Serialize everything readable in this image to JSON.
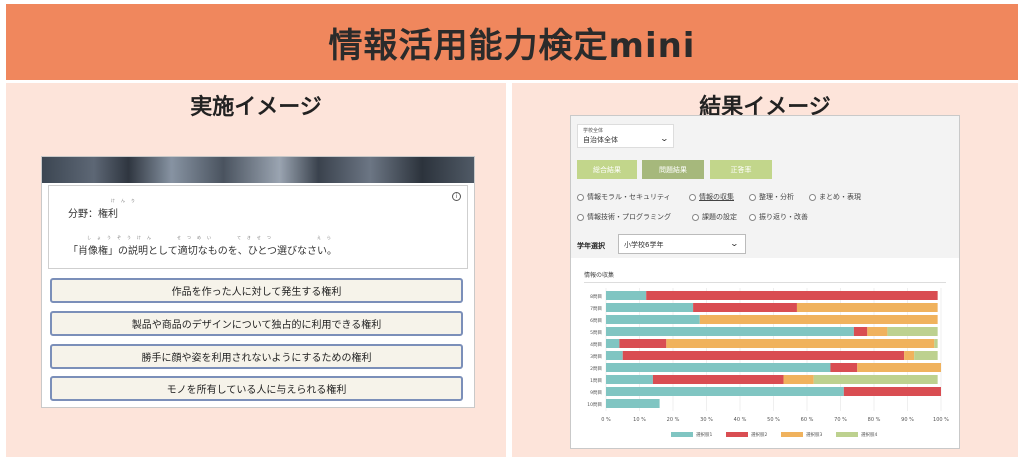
{
  "banner": {
    "title": "情報活用能力検定mini"
  },
  "left_panel": {
    "title": "実施イメージ",
    "quiz": {
      "field_label": "分野：権利",
      "question": "「肖像権」の説明として適切なものを、ひとつ選びなさい。",
      "answers": [
        "作品を作った人に対して発生する権利",
        "製品や商品のデザインについて独占的に利用できる権利",
        "勝手に顔や姿を利用されないようにするための権利",
        "モノを所有している人に与えられる権利"
      ]
    }
  },
  "right_panel": {
    "title": "結果イメージ",
    "dashboard": {
      "scope_select": {
        "label": "学校全体",
        "value": "自治体全体"
      },
      "tabs": [
        {
          "label": "総合結果",
          "color": "#c2d68b"
        },
        {
          "label": "問題結果",
          "color": "#a6b87c"
        },
        {
          "label": "正答率",
          "color": "#c2d68b"
        }
      ],
      "categories": [
        "情報モラル・セキュリティ",
        "情報の収集",
        "整理・分析",
        "まとめ・表現",
        "情報技術・プログラミング",
        "課題の設定",
        "振り返り・改善"
      ],
      "grade_label": "学年選択",
      "grade_value": "小学校6学年",
      "chart_title": "情報の収集"
    }
  },
  "chart_data": {
    "type": "bar",
    "orientation": "horizontal",
    "stacked": true,
    "percent": true,
    "title": "情報の収集",
    "categories": [
      "8問目",
      "7問目",
      "6問目",
      "5問目",
      "4問目",
      "3問目",
      "2問目",
      "1問目",
      "9問目",
      "10問目"
    ],
    "xlim": [
      0,
      100
    ],
    "x_ticks": [
      "0 %",
      "10 %",
      "20 %",
      "30 %",
      "40 %",
      "50 %",
      "60 %",
      "70 %",
      "80 %",
      "90 %",
      "100 %"
    ],
    "legend_position": "bottom",
    "series": [
      {
        "name": "選択肢1",
        "color": "#80c5c2",
        "values": [
          12,
          26,
          28,
          74,
          4,
          5,
          67,
          14,
          71,
          16
        ]
      },
      {
        "name": "選択肢2",
        "color": "#d94d52",
        "values": [
          87,
          31,
          0,
          4,
          14,
          84,
          8,
          39,
          29,
          0
        ]
      },
      {
        "name": "選択肢3",
        "color": "#f0b25d",
        "values": [
          0,
          42,
          71,
          6,
          80,
          3,
          25,
          9,
          0,
          0
        ]
      },
      {
        "name": "選択肢4",
        "color": "#bdd18f",
        "values": [
          0,
          0,
          0,
          15,
          1,
          7,
          0,
          37,
          0,
          0
        ]
      }
    ]
  }
}
